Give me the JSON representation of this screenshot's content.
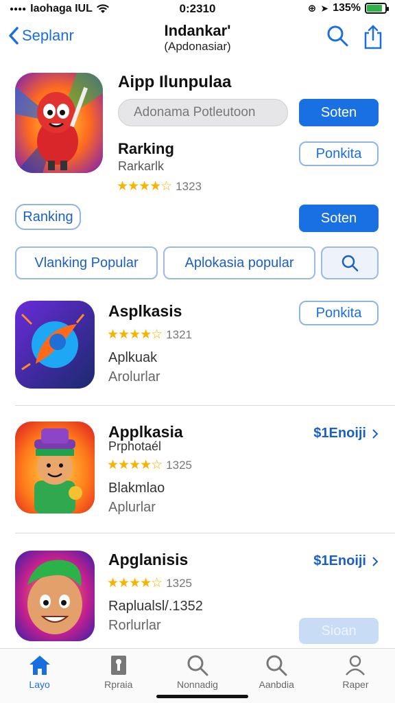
{
  "status": {
    "carrier": "Iaohaga IUL",
    "time": "0:2310",
    "battery": "135%",
    "battery_level": 0.85
  },
  "nav": {
    "back_label": "Seplanr",
    "title": "Indankar'",
    "subtitle": "(Apdonasiar)"
  },
  "featured": {
    "title": "Aipp Ilunpulaa",
    "search_placeholder": "Adonama Potleutoon",
    "primary_button": "Soten",
    "ranking_title": "Rarking",
    "ranking_sub": "Rarkarlk",
    "rating_stars": "★★★★☆",
    "rating_count": "1323",
    "outline_button": "Ponkita"
  },
  "ranking_pill": "Ranking",
  "ranking_button": "Soten",
  "filters": {
    "chip1": "Vlanking Popular",
    "chip2": "Aplokasia popular"
  },
  "apps": [
    {
      "name": "Asplkasis",
      "stars": "★★★★☆",
      "count": "1321",
      "line1": "Aplkuak",
      "line2": "Arolurlar",
      "action": "Ponkita"
    },
    {
      "name": "Applkasia",
      "tag": "Prphotaél",
      "stars": "★★★★☆",
      "count": "1325",
      "line1": "Blakmlao",
      "line2": "Aplurlar",
      "price": "$1Enoiji"
    },
    {
      "name": "Apglanisis",
      "stars": "★★★★☆",
      "count": "1325",
      "line1": "Raplualsl/.1352",
      "line2": "Rorlurlar",
      "price": "$1Enoiji",
      "bottom_button": "Sioan"
    }
  ],
  "tabs": [
    {
      "label": "Layo",
      "icon": "home-icon"
    },
    {
      "label": "Rpraia",
      "icon": "document-icon"
    },
    {
      "label": "Nonnadig",
      "icon": "search-icon"
    },
    {
      "label": "Aanbdia",
      "icon": "search-icon"
    },
    {
      "label": "Raper",
      "icon": "person-icon"
    }
  ],
  "colors": {
    "accent": "#1870e2",
    "star": "#f5b400"
  }
}
